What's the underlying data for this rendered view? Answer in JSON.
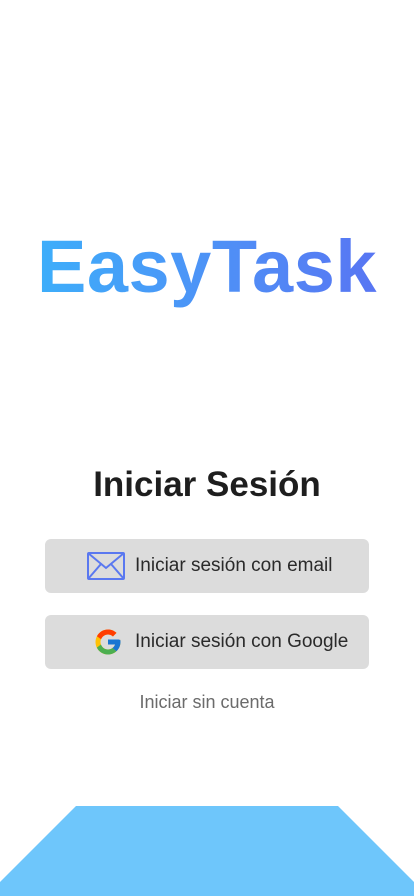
{
  "app": {
    "logo_text": "EasyTask"
  },
  "login": {
    "title": "Iniciar Sesión",
    "email_button_label": "Iniciar sesión con email",
    "email_button_icon": "envelope-icon",
    "google_button_label": "Iniciar sesión con Google",
    "google_button_icon": "google-icon",
    "guest_link_label": "Iniciar sin cuenta"
  },
  "colors": {
    "logo_gradient_start": "#3ab4fb",
    "logo_gradient_end": "#5a6ff2",
    "button_background": "#dcdcdc",
    "bottom_shape": "#6ec6fb",
    "envelope_icon": "#5a78f0"
  }
}
